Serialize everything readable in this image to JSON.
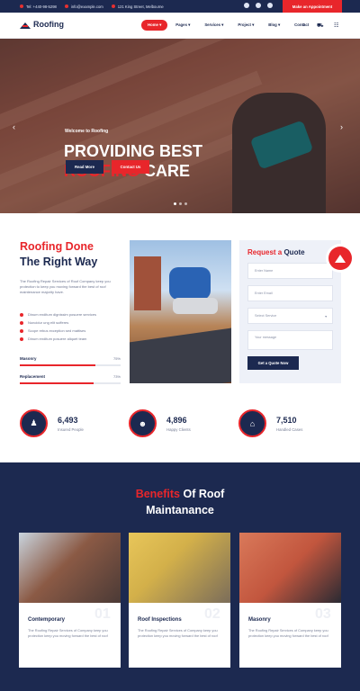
{
  "topbar": {
    "phone": "Tel: +440-98-5298",
    "email": "info@example.com",
    "address": "121 King Street, Melbourne",
    "appointment_label": "Make an Appointment"
  },
  "nav": {
    "brand": "Roofing",
    "items": [
      "Home ▾",
      "Pages ▾",
      "Services ▾",
      "Project ▾",
      "Blog ▾",
      "Contact"
    ],
    "active_index": 0
  },
  "hero": {
    "welcome": "Welcome to Roofing",
    "title_line1": "PROVIDING BEST",
    "title_red": "ROOFING",
    "title_rest": " CARE",
    "read_more": "Read More",
    "contact_us": "Contact Us"
  },
  "about": {
    "title_red": "Roofing Done",
    "title_dark": "The Right Way",
    "text": "The Roofing Repair Services of Roof Company keep you protection to keep you moving forward the best of roof maintenance majority have.",
    "list": [
      "Dinum enditum dignissim posuere services",
      "Nuncidur ung elit sufferes",
      "Scope rebus exception sed mattises",
      "Dinum enditum posuere aliquet team"
    ],
    "skills": [
      {
        "label": "Masonry",
        "percent": "75%",
        "value": 75
      },
      {
        "label": "Replacement",
        "percent": "73%",
        "value": 73
      }
    ]
  },
  "quote": {
    "title_red": "Request a",
    "title_dark": " Quote",
    "fields": [
      "Enter Name",
      "Enter Email",
      "Select Service",
      "Your message"
    ],
    "select_arrow": "▾",
    "submit": "Get a Quote Now"
  },
  "stats": [
    {
      "icon": "users-icon",
      "glyph": "♟",
      "value": "6,493",
      "label": "Insured People"
    },
    {
      "icon": "worker-icon",
      "glyph": "☻",
      "value": "4,896",
      "label": "Happy Clients"
    },
    {
      "icon": "house-icon",
      "glyph": "⌂",
      "value": "7,510",
      "label": "Handled Cases"
    }
  ],
  "benefits": {
    "title_red": "Benefits",
    "title_rest": " Of Roof",
    "title_line2": "Maintanance",
    "cards": [
      {
        "name": "Contemporary",
        "number": "01",
        "desc": "The Roofing Repair Services of Company keep you protection keep you moving forward the best of roof"
      },
      {
        "name": "Roof Inspections",
        "number": "02",
        "desc": "The Roofing Repair Services of Company keep you protection keep you moving forward the best of roof"
      },
      {
        "name": "Masonry",
        "number": "03",
        "desc": "The Roofing Repair Services of Company keep you protection keep you moving forward the best of roof"
      }
    ]
  },
  "colors": {
    "navy": "#1c2950",
    "red": "#e8262b"
  }
}
